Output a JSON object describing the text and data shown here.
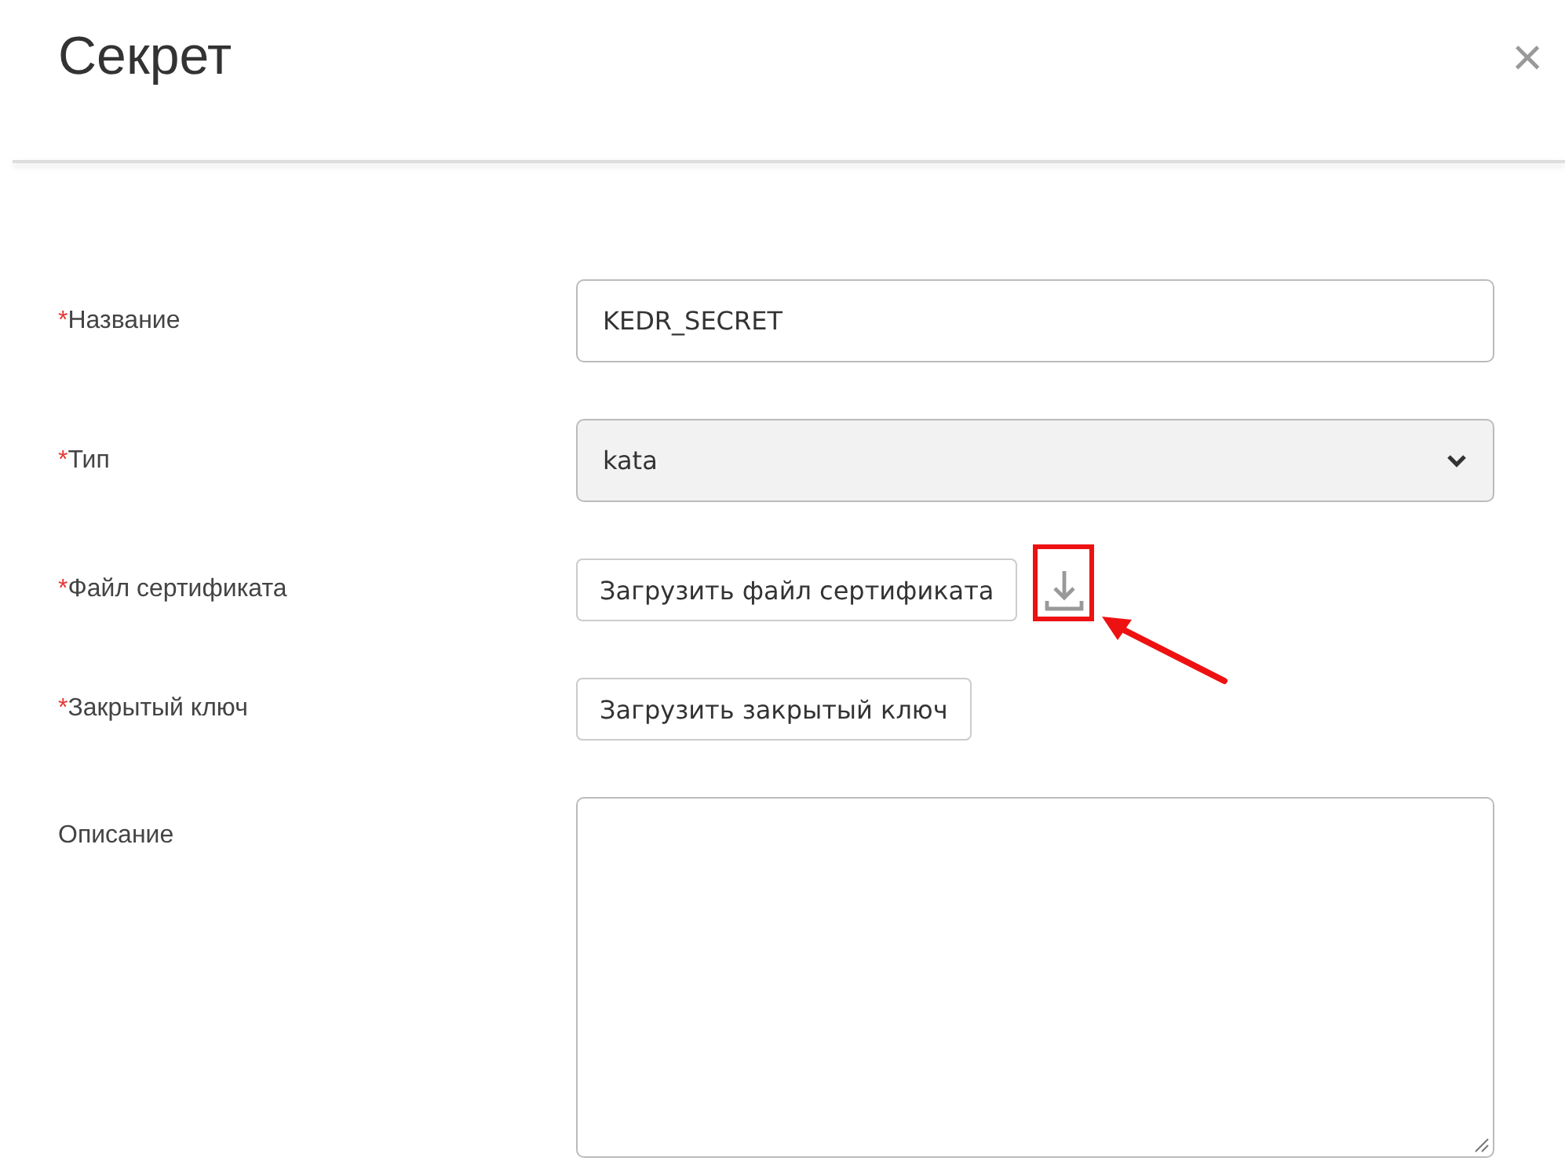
{
  "dialog": {
    "title": "Секрет",
    "close": "×"
  },
  "fields": [
    {
      "kind": "text",
      "mark": "*",
      "label": "Название",
      "value": "KEDR_SECRET"
    },
    {
      "kind": "select",
      "mark": "*",
      "label": "Тип",
      "value": "kata"
    },
    {
      "kind": "upload",
      "mark": "*",
      "label": "Файл сертификата",
      "button": "Загрузить файл сертификата",
      "download_icon": true,
      "highlighted": true
    },
    {
      "kind": "upload",
      "mark": "*",
      "label": "Закрытый ключ",
      "button": "Загрузить закрытый ключ",
      "download_icon": false,
      "highlighted": false
    },
    {
      "kind": "textarea",
      "label": "Описание"
    }
  ]
}
